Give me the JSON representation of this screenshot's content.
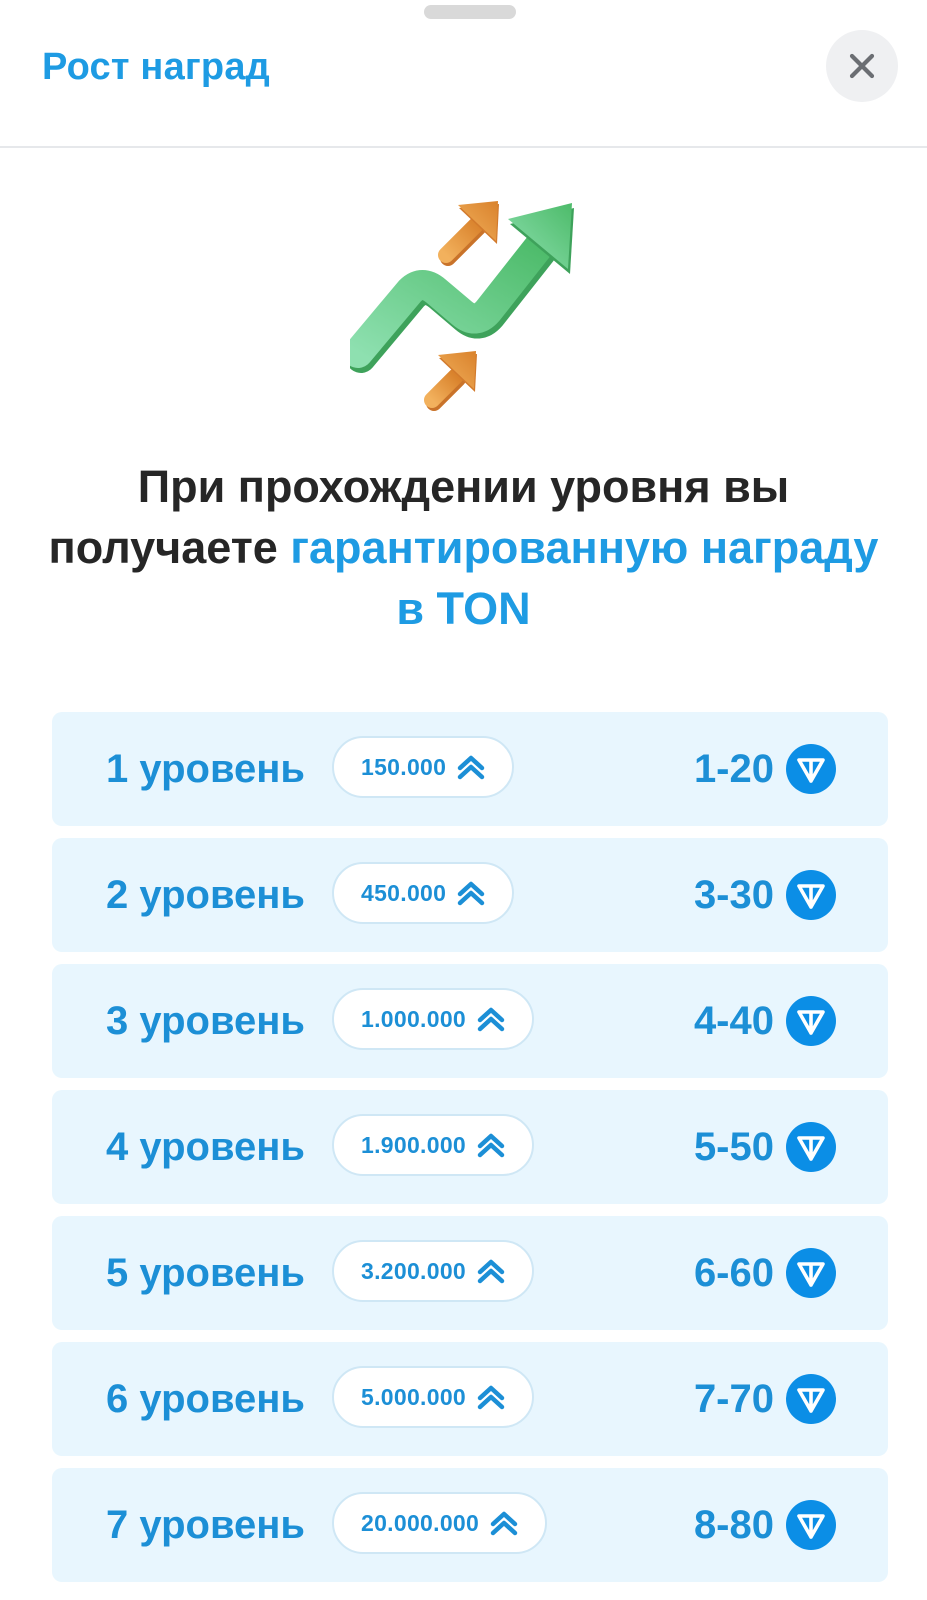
{
  "header": {
    "title": "Рост наград"
  },
  "headline": {
    "part1": "При прохождении уровня вы получаете ",
    "accent": "гарантированную награду в TON"
  },
  "levels": [
    {
      "label": "1 уровень",
      "points": "150.000",
      "reward": "1-20"
    },
    {
      "label": "2 уровень",
      "points": "450.000",
      "reward": "3-30"
    },
    {
      "label": "3 уровень",
      "points": "1.000.000",
      "reward": "4-40"
    },
    {
      "label": "4 уровень",
      "points": "1.900.000",
      "reward": "5-50"
    },
    {
      "label": "5 уровень",
      "points": "3.200.000",
      "reward": "6-60"
    },
    {
      "label": "6 уровень",
      "points": "5.000.000",
      "reward": "7-70"
    },
    {
      "label": "7 уровень",
      "points": "20.000.000",
      "reward": "8-80"
    }
  ],
  "icons": {
    "close": "close-icon",
    "growth": "growth-arrows-icon",
    "points": "double-chevron-up-icon",
    "currency": "ton-icon"
  },
  "colors": {
    "accent": "#1e9be3",
    "row_background": "#e8f6fe",
    "text_dark": "#262626",
    "arrow_green": "#5cc47e",
    "arrow_orange": "#e8953a"
  }
}
